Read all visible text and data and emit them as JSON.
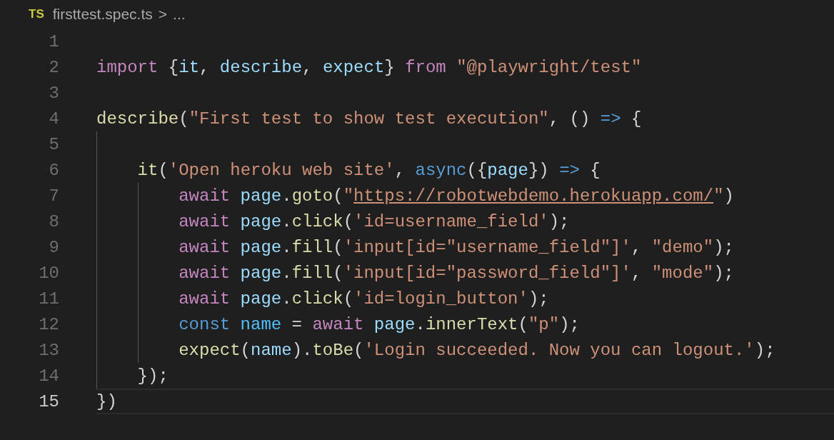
{
  "breadcrumb": {
    "file_badge": "TS",
    "file": "firsttest.spec.ts",
    "separator": ">",
    "more": "..."
  },
  "lines": [
    {
      "number": "1",
      "selected": false
    },
    {
      "number": "2",
      "selected": false,
      "tokens": [
        {
          "kind": "keyword",
          "text": "import"
        },
        {
          "kind": "plain",
          "text": " {"
        },
        {
          "kind": "variable",
          "text": "it"
        },
        {
          "kind": "plain",
          "text": ", "
        },
        {
          "kind": "variable",
          "text": "describe"
        },
        {
          "kind": "plain",
          "text": ", "
        },
        {
          "kind": "variable",
          "text": "expect"
        },
        {
          "kind": "plain",
          "text": "} "
        },
        {
          "kind": "keyword",
          "text": "from"
        },
        {
          "kind": "string",
          "text": " \"@playwright/test\""
        }
      ]
    },
    {
      "number": "3",
      "selected": false
    },
    {
      "number": "4",
      "selected": false,
      "tokens": [
        {
          "kind": "function",
          "text": "describe"
        },
        {
          "kind": "plain",
          "text": "("
        },
        {
          "kind": "string",
          "text": "\"First test to show test execution\""
        },
        {
          "kind": "plain",
          "text": ", () "
        },
        {
          "kind": "storage",
          "text": "=>"
        },
        {
          "kind": "plain",
          "text": " {"
        }
      ],
      "children": [
        {
          "number": "5",
          "selected": false
        },
        {
          "number": "6",
          "selected": false,
          "tokens": [
            {
              "kind": "function",
              "text": "it"
            },
            {
              "kind": "plain",
              "text": "("
            },
            {
              "kind": "string",
              "text": "'Open heroku web site'"
            },
            {
              "kind": "plain",
              "text": ", "
            },
            {
              "kind": "storage",
              "text": "async"
            },
            {
              "kind": "plain",
              "text": "({"
            },
            {
              "kind": "variable",
              "text": "page"
            },
            {
              "kind": "plain",
              "text": "}) "
            },
            {
              "kind": "storage",
              "text": "=>"
            },
            {
              "kind": "plain",
              "text": " {"
            }
          ],
          "children": [
            {
              "number": "7",
              "selected": false,
              "tokens": [
                {
                  "kind": "keyword",
                  "text": "await"
                },
                {
                  "kind": "variable",
                  "text": " page"
                },
                {
                  "kind": "plain",
                  "text": "."
                },
                {
                  "kind": "function",
                  "text": "goto"
                },
                {
                  "kind": "plain",
                  "text": "("
                },
                {
                  "kind": "string",
                  "text": "\""
                },
                {
                  "kind": "link",
                  "text": "https://robotwebdemo.herokuapp.com/"
                },
                {
                  "kind": "string",
                  "text": "\""
                },
                {
                  "kind": "plain",
                  "text": ")"
                }
              ]
            },
            {
              "number": "8",
              "selected": false,
              "tokens": [
                {
                  "kind": "keyword",
                  "text": "await"
                },
                {
                  "kind": "variable",
                  "text": " page"
                },
                {
                  "kind": "plain",
                  "text": "."
                },
                {
                  "kind": "function",
                  "text": "click"
                },
                {
                  "kind": "plain",
                  "text": "("
                },
                {
                  "kind": "string",
                  "text": "'id=username_field'"
                },
                {
                  "kind": "plain",
                  "text": ");"
                }
              ]
            },
            {
              "number": "9",
              "selected": false,
              "tokens": [
                {
                  "kind": "keyword",
                  "text": "await"
                },
                {
                  "kind": "variable",
                  "text": " page"
                },
                {
                  "kind": "plain",
                  "text": "."
                },
                {
                  "kind": "function",
                  "text": "fill"
                },
                {
                  "kind": "plain",
                  "text": "("
                },
                {
                  "kind": "string",
                  "text": "'input[id=\"username_field\"]'"
                },
                {
                  "kind": "plain",
                  "text": ", "
                },
                {
                  "kind": "string",
                  "text": "\"demo\""
                },
                {
                  "kind": "plain",
                  "text": ");"
                }
              ]
            },
            {
              "number": "10",
              "selected": false,
              "tokens": [
                {
                  "kind": "keyword",
                  "text": "await"
                },
                {
                  "kind": "variable",
                  "text": " page"
                },
                {
                  "kind": "plain",
                  "text": "."
                },
                {
                  "kind": "function",
                  "text": "fill"
                },
                {
                  "kind": "plain",
                  "text": "("
                },
                {
                  "kind": "string",
                  "text": "'input[id=\"password_field\"]'"
                },
                {
                  "kind": "plain",
                  "text": ", "
                },
                {
                  "kind": "string",
                  "text": "\"mode\""
                },
                {
                  "kind": "plain",
                  "text": ");"
                }
              ]
            },
            {
              "number": "11",
              "selected": false,
              "tokens": [
                {
                  "kind": "keyword",
                  "text": "await"
                },
                {
                  "kind": "variable",
                  "text": " page"
                },
                {
                  "kind": "plain",
                  "text": "."
                },
                {
                  "kind": "function",
                  "text": "click"
                },
                {
                  "kind": "plain",
                  "text": "("
                },
                {
                  "kind": "string",
                  "text": "'id=login_button'"
                },
                {
                  "kind": "plain",
                  "text": ");"
                }
              ]
            },
            {
              "number": "12",
              "selected": false,
              "tokens": [
                {
                  "kind": "storage",
                  "text": "const"
                },
                {
                  "kind": "constant",
                  "text": " name"
                },
                {
                  "kind": "plain",
                  "text": " = "
                },
                {
                  "kind": "keyword",
                  "text": "await"
                },
                {
                  "kind": "variable",
                  "text": " page"
                },
                {
                  "kind": "plain",
                  "text": "."
                },
                {
                  "kind": "function",
                  "text": "innerText"
                },
                {
                  "kind": "plain",
                  "text": "("
                },
                {
                  "kind": "string",
                  "text": "\"p\""
                },
                {
                  "kind": "plain",
                  "text": ");"
                }
              ]
            },
            {
              "number": "13",
              "selected": false,
              "tokens": [
                {
                  "kind": "function",
                  "text": "expect"
                },
                {
                  "kind": "plain",
                  "text": "("
                },
                {
                  "kind": "variable",
                  "text": "name"
                },
                {
                  "kind": "plain",
                  "text": ")."
                },
                {
                  "kind": "function",
                  "text": "toBe"
                },
                {
                  "kind": "plain",
                  "text": "("
                },
                {
                  "kind": "string",
                  "text": "'Login succeeded. Now you can logout.'"
                },
                {
                  "kind": "plain",
                  "text": ");"
                }
              ]
            }
          ]
        },
        {
          "number": "14",
          "selected": false,
          "tokens": [
            {
              "kind": "plain",
              "text": "});"
            }
          ]
        }
      ]
    },
    {
      "number": "15",
      "selected": true,
      "tokens": [
        {
          "kind": "plain",
          "text": "})"
        }
      ]
    }
  ]
}
